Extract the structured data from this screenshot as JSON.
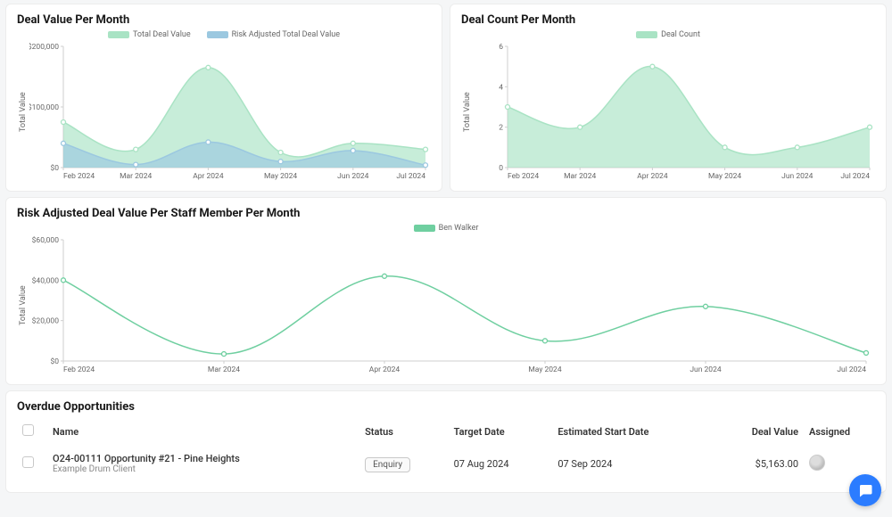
{
  "panels": {
    "deal_value": {
      "title": "Deal Value Per Month",
      "ylabel": "Total Value",
      "legend": [
        "Total Deal Value",
        "Risk Adjusted Total Deal Value"
      ]
    },
    "deal_count": {
      "title": "Deal Count Per Month",
      "ylabel": "Total Value",
      "legend": [
        "Deal Count"
      ]
    },
    "risk_staff": {
      "title": "Risk Adjusted Deal Value Per Staff Member Per Month",
      "ylabel": "Total Value",
      "legend": [
        "Ben Walker"
      ]
    },
    "overdue": {
      "title": "Overdue Opportunities",
      "columns": {
        "name": "Name",
        "status": "Status",
        "target": "Target Date",
        "est_start": "Estimated Start Date",
        "deal_value": "Deal Value",
        "assigned": "Assigned"
      },
      "rows": [
        {
          "name": "O24-00111 Opportunity #21 - Pine Heights",
          "client": "Example Drum Client",
          "status": "Enquiry",
          "target": "07 Aug 2024",
          "est_start": "07 Sep 2024",
          "deal_value": "$5,163.00"
        }
      ]
    }
  },
  "colors": {
    "green_fill": "#a9e3c4",
    "green_stroke": "#6fcfa0",
    "blue_fill": "#9bc8e0",
    "blue_stroke": "#6fb5d8"
  },
  "chart_data": [
    {
      "id": "deal_value",
      "type": "area",
      "title": "Deal Value Per Month",
      "ylabel": "Total Value",
      "categories": [
        "Feb 2024",
        "Mar 2024",
        "Apr 2024",
        "May 2024",
        "Jun 2024",
        "Jul 2024"
      ],
      "yticks": [
        0,
        100000,
        200000
      ],
      "ytick_labels": [
        "$0",
        "$100,000",
        "$200,000"
      ],
      "ylim": [
        0,
        200000
      ],
      "series": [
        {
          "name": "Total Deal Value",
          "values": [
            75000,
            30000,
            165000,
            25000,
            40000,
            30000
          ],
          "color": "#a9e3c4"
        },
        {
          "name": "Risk Adjusted Total Deal Value",
          "values": [
            40000,
            5000,
            42000,
            10000,
            28000,
            4000
          ],
          "color": "#9bc8e0"
        }
      ]
    },
    {
      "id": "deal_count",
      "type": "area",
      "title": "Deal Count Per Month",
      "ylabel": "Total Value",
      "categories": [
        "Feb 2024",
        "Mar 2024",
        "Apr 2024",
        "May 2024",
        "Jun 2024",
        "Jul 2024"
      ],
      "yticks": [
        0,
        2,
        4,
        6
      ],
      "ytick_labels": [
        "0",
        "2",
        "4",
        "6"
      ],
      "ylim": [
        0,
        6
      ],
      "series": [
        {
          "name": "Deal Count",
          "values": [
            3,
            2,
            5,
            1,
            1,
            2
          ],
          "color": "#a9e3c4"
        }
      ]
    },
    {
      "id": "risk_staff",
      "type": "line",
      "title": "Risk Adjusted Deal Value Per Staff Member Per Month",
      "ylabel": "Total Value",
      "categories": [
        "Feb 2024",
        "Mar 2024",
        "Apr 2024",
        "May 2024",
        "Jun 2024",
        "Jul 2024"
      ],
      "yticks": [
        0,
        20000,
        40000,
        60000
      ],
      "ytick_labels": [
        "$0",
        "$20,000",
        "$40,000",
        "$60,000"
      ],
      "ylim": [
        0,
        60000
      ],
      "series": [
        {
          "name": "Ben Walker",
          "values": [
            40000,
            3500,
            42000,
            10000,
            27000,
            4000
          ],
          "color": "#6fcfa0"
        }
      ]
    }
  ]
}
